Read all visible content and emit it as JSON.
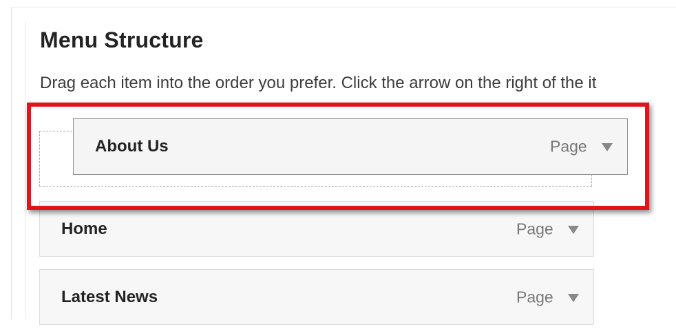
{
  "section": {
    "title": "Menu Structure",
    "instructions": "Drag each item into the order you prefer. Click the arrow on the right of the it"
  },
  "dragging_item": {
    "title": "About Us",
    "type": "Page",
    "toggle_icon": "triangle-down-icon"
  },
  "menu_items": [
    {
      "title": "Home",
      "type": "Page",
      "toggle_icon": "triangle-down-icon"
    },
    {
      "title": "Latest News",
      "type": "Page",
      "toggle_icon": "triangle-down-icon"
    }
  ],
  "colors": {
    "highlight": "#e0141a",
    "item_background": "#f7f7f7",
    "item_border": "#dcdcdc",
    "title_text": "#232323",
    "type_text": "#777777"
  }
}
